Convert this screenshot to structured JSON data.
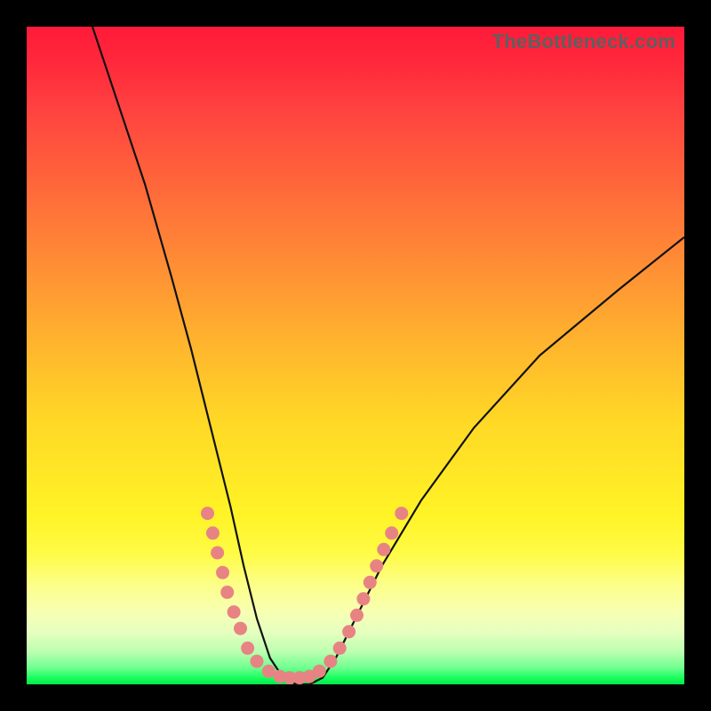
{
  "watermark": "TheBottleneck.com",
  "colors": {
    "frame": "#000000",
    "gradient_top": "#ff1a3a",
    "gradient_bottom": "#00e84a",
    "curve": "#111111",
    "dot": "#e88383"
  },
  "chart_data": {
    "type": "line",
    "title": "",
    "xlabel": "",
    "ylabel": "",
    "xlim": [
      0,
      100
    ],
    "ylim": [
      0,
      100
    ],
    "grid": false,
    "legend": null,
    "description": "Bottleneck-style V-curve: steep black curve descending from top-left to a flat bottom valley near x≈35–45 (y≈0), then rising to the right. Small pink dots trace the lower portion of the curve near the valley. Background is a vertical red→yellow→green gradient. No axes, ticks, or labels.",
    "series": [
      {
        "name": "bottleneck_curve",
        "x": [
          10,
          14,
          18,
          22,
          25,
          27,
          29,
          31,
          33,
          35,
          37,
          39,
          41,
          43,
          45,
          47,
          50,
          54,
          60,
          68,
          78,
          90,
          100
        ],
        "y": [
          100,
          88,
          76,
          62,
          51,
          43,
          35,
          27,
          18,
          10,
          4,
          1,
          0,
          0,
          1,
          4,
          10,
          18,
          28,
          39,
          50,
          60,
          68
        ]
      }
    ],
    "dots": [
      {
        "x": 27.5,
        "y": 26
      },
      {
        "x": 28.3,
        "y": 23
      },
      {
        "x": 29.0,
        "y": 20
      },
      {
        "x": 29.8,
        "y": 17
      },
      {
        "x": 30.5,
        "y": 14
      },
      {
        "x": 31.5,
        "y": 11
      },
      {
        "x": 32.5,
        "y": 8.5
      },
      {
        "x": 33.6,
        "y": 5.5
      },
      {
        "x": 35.0,
        "y": 3.5
      },
      {
        "x": 36.8,
        "y": 2.0
      },
      {
        "x": 38.5,
        "y": 1.2
      },
      {
        "x": 40.0,
        "y": 1.0
      },
      {
        "x": 41.5,
        "y": 1.0
      },
      {
        "x": 43.0,
        "y": 1.2
      },
      {
        "x": 44.5,
        "y": 2.0
      },
      {
        "x": 46.2,
        "y": 3.5
      },
      {
        "x": 47.6,
        "y": 5.5
      },
      {
        "x": 49.0,
        "y": 8.0
      },
      {
        "x": 50.2,
        "y": 10.5
      },
      {
        "x": 51.2,
        "y": 13
      },
      {
        "x": 52.2,
        "y": 15.5
      },
      {
        "x": 53.2,
        "y": 18
      },
      {
        "x": 54.3,
        "y": 20.5
      },
      {
        "x": 55.5,
        "y": 23
      },
      {
        "x": 57.0,
        "y": 26
      }
    ]
  }
}
